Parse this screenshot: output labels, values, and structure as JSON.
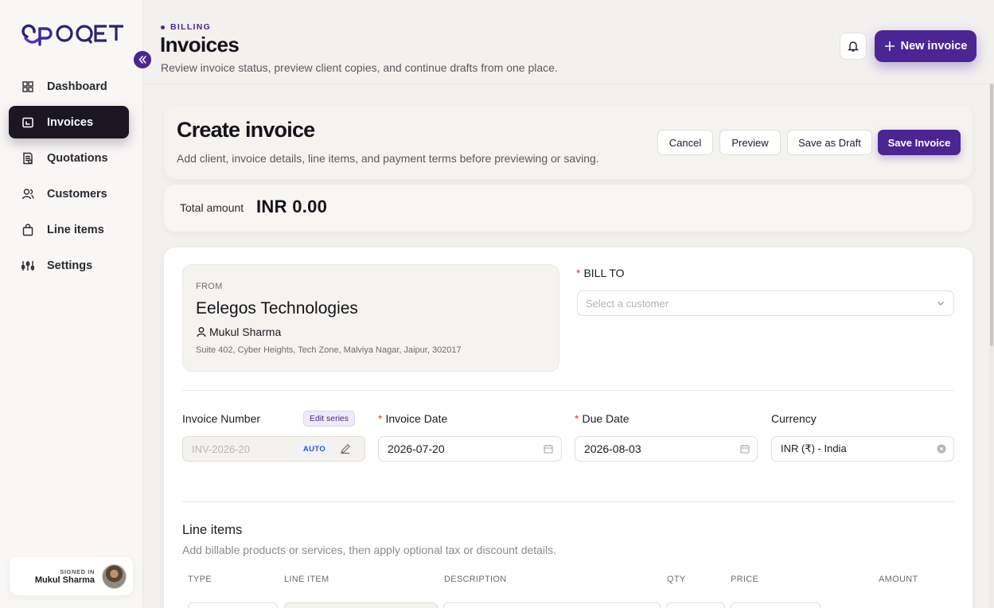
{
  "brand": {
    "logo_text": "OPOQET",
    "accent": "#4b2594"
  },
  "sidebar": {
    "items": [
      {
        "label": "Dashboard",
        "icon": "grid-icon"
      },
      {
        "label": "Invoices",
        "icon": "invoice-icon",
        "active": true
      },
      {
        "label": "Quotations",
        "icon": "quotation-icon"
      },
      {
        "label": "Customers",
        "icon": "users-icon"
      },
      {
        "label": "Line items",
        "icon": "bag-icon"
      },
      {
        "label": "Settings",
        "icon": "sliders-icon"
      }
    ],
    "user": {
      "signed_in_label": "SIGNED IN",
      "name": "Mukul Sharma"
    }
  },
  "header": {
    "breadcrumb": "BILLING",
    "title": "Invoices",
    "subtitle": "Review invoice status, preview client copies, and continue drafts from one place.",
    "new_invoice_label": "New invoice"
  },
  "create": {
    "title": "Create invoice",
    "subtitle": "Add client, invoice details, line items, and payment terms before previewing or saving.",
    "cancel_label": "Cancel",
    "preview_label": "Preview",
    "save_draft_label": "Save as Draft",
    "save_label": "Save Invoice"
  },
  "total": {
    "label": "Total amount",
    "value": "INR 0.00"
  },
  "from": {
    "label": "FROM",
    "company": "Eelegos Technologies",
    "contact": "Mukul Sharma",
    "address": "Suite 402, Cyber Heights, Tech Zone, Malviya Nagar, Jaipur, 302017"
  },
  "bill_to": {
    "required_mark": "*",
    "label": "BILL TO",
    "placeholder": "Select a customer"
  },
  "details": {
    "invoice_number_label": "Invoice Number",
    "edit_series_label": "Edit series",
    "invoice_number_value": "INV-2026-20",
    "auto_badge": "AUTO",
    "invoice_date_label": "Invoice Date",
    "invoice_date_value": "2026-07-20",
    "due_date_label": "Due Date",
    "due_date_value": "2026-08-03",
    "currency_label": "Currency",
    "currency_value": "INR (₹) - India"
  },
  "line_items": {
    "title": "Line items",
    "subtitle": "Add billable products or services, then apply optional tax or discount details.",
    "columns": [
      "TYPE",
      "LINE ITEM",
      "DESCRIPTION",
      "QTY",
      "PRICE",
      "AMOUNT"
    ]
  }
}
